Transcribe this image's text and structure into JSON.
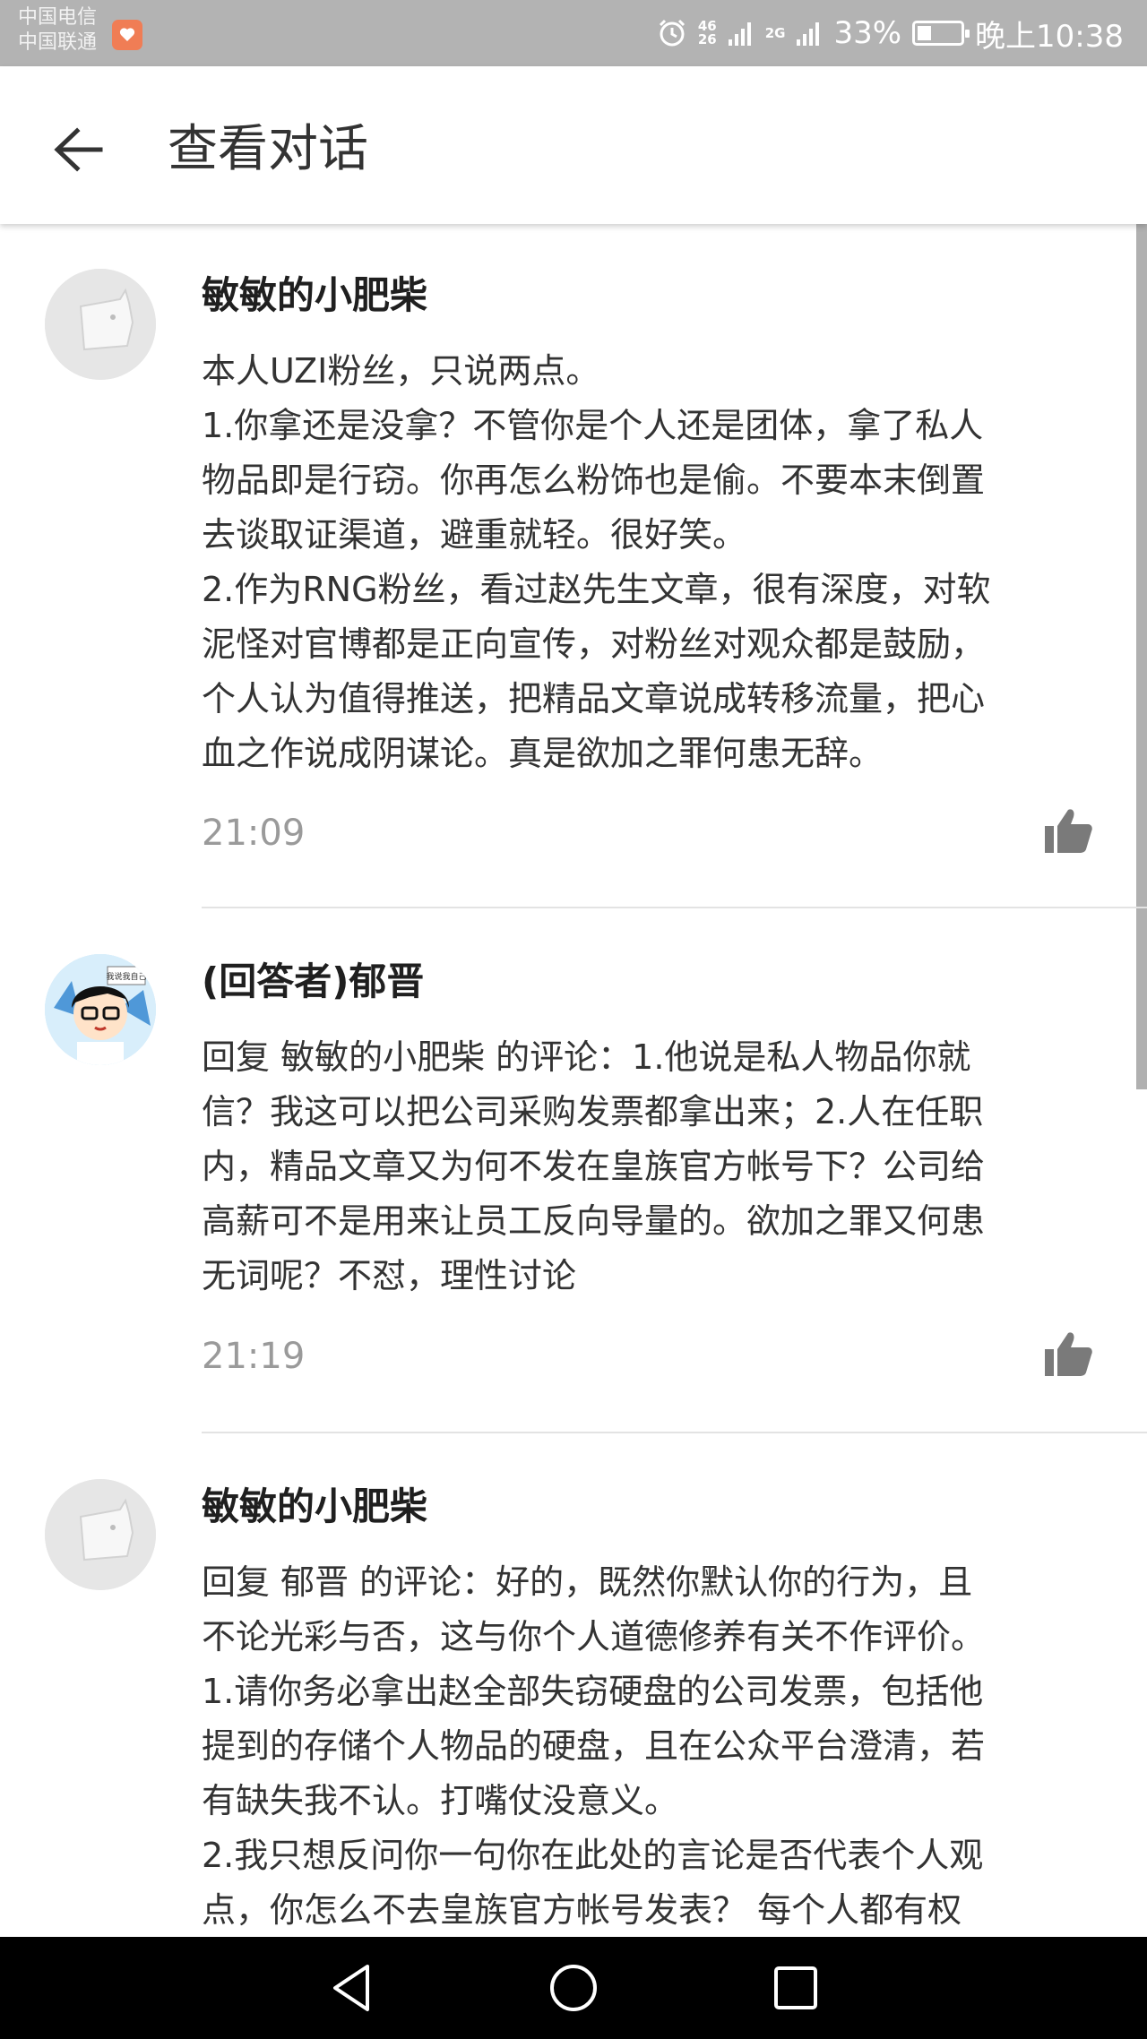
{
  "status_bar": {
    "carrier1": "中国电信",
    "carrier2": "中国联通",
    "signal1_top": "46",
    "signal1_bottom": "26",
    "signal2_label": "2G",
    "battery": "33%",
    "time": "晚上10:38"
  },
  "app_bar": {
    "title": "查看对话"
  },
  "comments": [
    {
      "author": "敏敏的小肥柴",
      "lines": [
        "本人UZI粉丝，只说两点。",
        "1.你拿还是没拿？不管你是个人还是团体，拿了私人",
        "物品即是行窃。你再怎么粉饰也是偷。不要本末倒置",
        "去谈取证渠道，避重就轻。很好笑。",
        "2.作为RNG粉丝，看过赵先生文章，很有深度，对软",
        "泥怪对官博都是正向宣传，对粉丝对观众都是鼓励，",
        "个人认为值得推送，把精品文章说成转移流量，把心",
        "血之作说成阴谋论。真是欲加之罪何患无辞。"
      ],
      "time": "21:09"
    },
    {
      "author": "(回答者)郁晋",
      "avatar_text": "我说我自己",
      "lines": [
        "回复 敏敏的小肥柴 的评论：1.他说是私人物品你就",
        "信？我这可以把公司采购发票都拿出来；2.人在任职",
        "内，精品文章又为何不发在皇族官方帐号下？公司给",
        "高薪可不是用来让员工反向导量的。欲加之罪又何患",
        "无词呢？不怼，理性讨论"
      ],
      "time": "21:19"
    },
    {
      "author": "敏敏的小肥柴",
      "lines": [
        "回复 郁晋 的评论：好的，既然你默认你的行为，且",
        "不论光彩与否，这与你个人道德修养有关不作评价。",
        "1.请你务必拿出赵全部失窃硬盘的公司发票，包括他",
        "提到的存储个人物品的硬盘，且在公众平台澄清，若",
        "有缺失我不认。打嘴仗没意义。",
        "2.我只想反问你一句你在此处的言论是否代表个人观",
        "点，你怎么不去皇族官方帐号发表？ 每个人都有权"
      ]
    }
  ],
  "colors": {
    "status_bar_bg": "#b3b3b3",
    "nav_bar_bg": "#000000",
    "time_text": "#9a9a9a",
    "like_icon": "#7a7a7a",
    "notif_badge": "#f07d55"
  }
}
